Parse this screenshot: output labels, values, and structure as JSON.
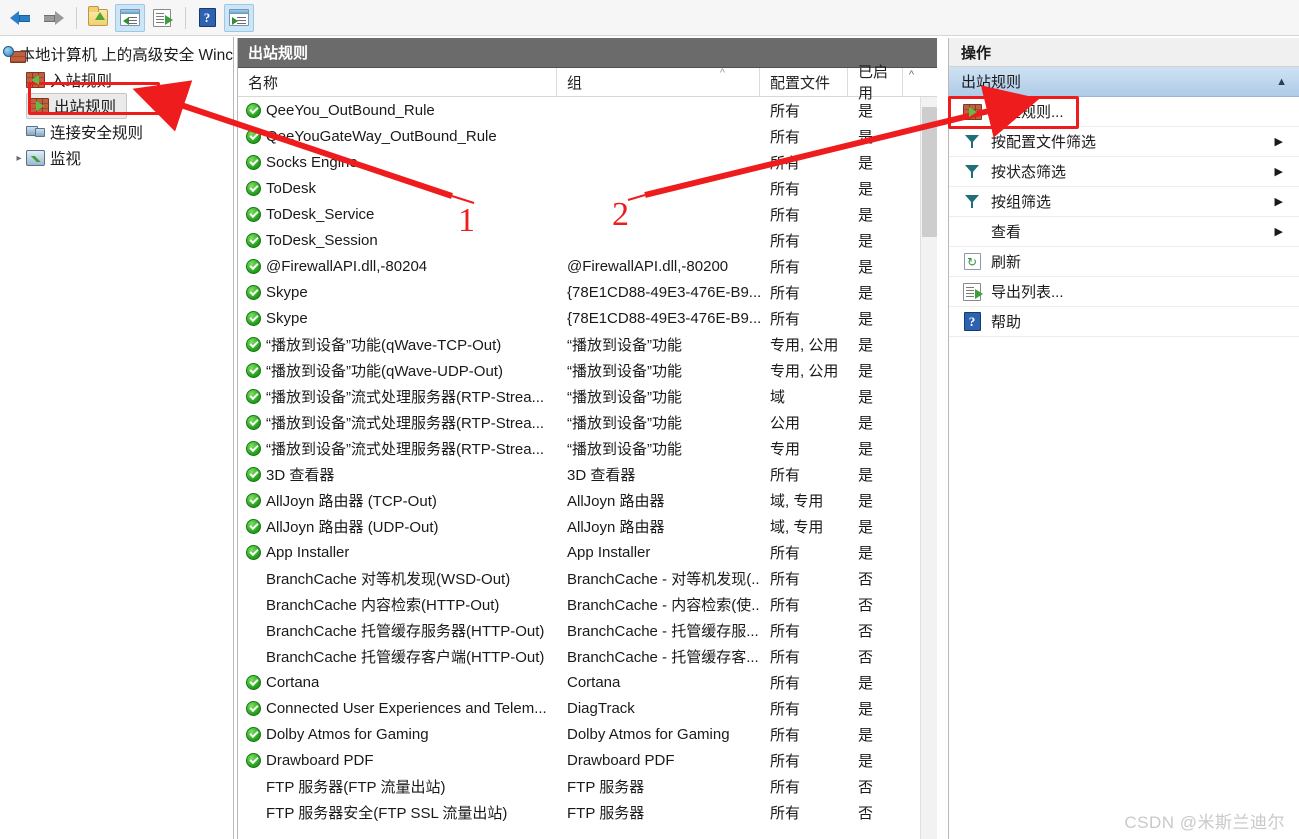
{
  "toolbar": {
    "buttons": [
      {
        "name": "back-arrow-icon",
        "label": "后退"
      },
      {
        "name": "forward-arrow-icon",
        "label": "前进"
      },
      {
        "name": "up-folder-icon",
        "label": "向上"
      },
      {
        "name": "show-tree-icon",
        "label": "显示/隐藏控制台树"
      },
      {
        "name": "export-list-icon",
        "label": "导出列表"
      },
      {
        "name": "help-icon",
        "label": "帮助"
      },
      {
        "name": "show-action-pane-icon",
        "label": "显示/隐藏操作窗格"
      }
    ]
  },
  "tree": {
    "root": "本地计算机 上的高级安全 Winc",
    "items": [
      {
        "label": "入站规则",
        "icon": "inbound-rules-icon"
      },
      {
        "label": "出站规则",
        "icon": "outbound-rules-icon"
      },
      {
        "label": "连接安全规则",
        "icon": "connection-security-rules-icon"
      },
      {
        "label": "监视",
        "icon": "monitoring-icon"
      }
    ]
  },
  "center": {
    "title": "出站规则",
    "columns": [
      "名称",
      "组",
      "配置文件",
      "已启用"
    ],
    "rows": [
      {
        "enabled_icon": true,
        "name": "QeeYou_OutBound_Rule",
        "group": "",
        "profile": "所有",
        "enabled": "是"
      },
      {
        "enabled_icon": true,
        "name": "QeeYouGateWay_OutBound_Rule",
        "group": "",
        "profile": "所有",
        "enabled": "是"
      },
      {
        "enabled_icon": true,
        "name": "Socks Engine",
        "group": "",
        "profile": "所有",
        "enabled": "是"
      },
      {
        "enabled_icon": true,
        "name": "ToDesk",
        "group": "",
        "profile": "所有",
        "enabled": "是"
      },
      {
        "enabled_icon": true,
        "name": "ToDesk_Service",
        "group": "",
        "profile": "所有",
        "enabled": "是"
      },
      {
        "enabled_icon": true,
        "name": "ToDesk_Session",
        "group": "",
        "profile": "所有",
        "enabled": "是"
      },
      {
        "enabled_icon": true,
        "name": "@FirewallAPI.dll,-80204",
        "group": "@FirewallAPI.dll,-80200",
        "profile": "所有",
        "enabled": "是"
      },
      {
        "enabled_icon": true,
        "name": "Skype",
        "group": "{78E1CD88-49E3-476E-B9...",
        "profile": "所有",
        "enabled": "是"
      },
      {
        "enabled_icon": true,
        "name": "Skype",
        "group": "{78E1CD88-49E3-476E-B9...",
        "profile": "所有",
        "enabled": "是"
      },
      {
        "enabled_icon": true,
        "name": "“播放到设备”功能(qWave-TCP-Out)",
        "group": "“播放到设备”功能",
        "profile": "专用, 公用",
        "enabled": "是"
      },
      {
        "enabled_icon": true,
        "name": "“播放到设备”功能(qWave-UDP-Out)",
        "group": "“播放到设备”功能",
        "profile": "专用, 公用",
        "enabled": "是"
      },
      {
        "enabled_icon": true,
        "name": "“播放到设备”流式处理服务器(RTP-Strea...",
        "group": "“播放到设备”功能",
        "profile": "域",
        "enabled": "是"
      },
      {
        "enabled_icon": true,
        "name": "“播放到设备”流式处理服务器(RTP-Strea...",
        "group": "“播放到设备”功能",
        "profile": "公用",
        "enabled": "是"
      },
      {
        "enabled_icon": true,
        "name": "“播放到设备”流式处理服务器(RTP-Strea...",
        "group": "“播放到设备”功能",
        "profile": "专用",
        "enabled": "是"
      },
      {
        "enabled_icon": true,
        "name": "3D 查看器",
        "group": "3D 查看器",
        "profile": "所有",
        "enabled": "是"
      },
      {
        "enabled_icon": true,
        "name": "AllJoyn 路由器 (TCP-Out)",
        "group": "AllJoyn 路由器",
        "profile": "域, 专用",
        "enabled": "是"
      },
      {
        "enabled_icon": true,
        "name": "AllJoyn 路由器 (UDP-Out)",
        "group": "AllJoyn 路由器",
        "profile": "域, 专用",
        "enabled": "是"
      },
      {
        "enabled_icon": true,
        "name": "App Installer",
        "group": "App Installer",
        "profile": "所有",
        "enabled": "是"
      },
      {
        "enabled_icon": false,
        "name": "BranchCache 对等机发现(WSD-Out)",
        "group": "BranchCache - 对等机发现(...",
        "profile": "所有",
        "enabled": "否"
      },
      {
        "enabled_icon": false,
        "name": "BranchCache 内容检索(HTTP-Out)",
        "group": "BranchCache - 内容检索(使...",
        "profile": "所有",
        "enabled": "否"
      },
      {
        "enabled_icon": false,
        "name": "BranchCache 托管缓存服务器(HTTP-Out)",
        "group": "BranchCache - 托管缓存服...",
        "profile": "所有",
        "enabled": "否"
      },
      {
        "enabled_icon": false,
        "name": "BranchCache 托管缓存客户端(HTTP-Out)",
        "group": "BranchCache - 托管缓存客...",
        "profile": "所有",
        "enabled": "否"
      },
      {
        "enabled_icon": true,
        "name": "Cortana",
        "group": "Cortana",
        "profile": "所有",
        "enabled": "是"
      },
      {
        "enabled_icon": true,
        "name": "Connected User Experiences and Telem...",
        "group": "DiagTrack",
        "profile": "所有",
        "enabled": "是"
      },
      {
        "enabled_icon": true,
        "name": "Dolby Atmos for Gaming",
        "group": "Dolby Atmos for Gaming",
        "profile": "所有",
        "enabled": "是"
      },
      {
        "enabled_icon": true,
        "name": "Drawboard PDF",
        "group": "Drawboard PDF",
        "profile": "所有",
        "enabled": "是"
      },
      {
        "enabled_icon": false,
        "name": "FTP 服务器(FTP 流量出站)",
        "group": "FTP 服务器",
        "profile": "所有",
        "enabled": "否"
      },
      {
        "enabled_icon": false,
        "name": "FTP 服务器安全(FTP SSL 流量出站)",
        "group": "FTP 服务器",
        "profile": "所有",
        "enabled": "否"
      }
    ]
  },
  "actions": {
    "title": "操作",
    "subtitle": "出站规则",
    "collapse_caret": "▲",
    "items": [
      {
        "label": "新建规则...",
        "icon": "new-rule-icon",
        "submenu": false
      },
      {
        "label": "按配置文件筛选",
        "icon": "filter-icon",
        "submenu": true
      },
      {
        "label": "按状态筛选",
        "icon": "filter-icon",
        "submenu": true
      },
      {
        "label": "按组筛选",
        "icon": "filter-icon",
        "submenu": true
      },
      {
        "label": "查看",
        "icon": "none",
        "submenu": true
      },
      {
        "label": "刷新",
        "icon": "refresh-icon",
        "submenu": false
      },
      {
        "label": "导出列表...",
        "icon": "export-icon",
        "submenu": false
      },
      {
        "label": "帮助",
        "icon": "help-icon",
        "submenu": false
      }
    ],
    "submenu_caret": "▶"
  },
  "annotations": {
    "marker_1": "1",
    "marker_2": "2",
    "accent_color": "#ee1c1c"
  },
  "watermark": "CSDN @米斯兰迪尔"
}
